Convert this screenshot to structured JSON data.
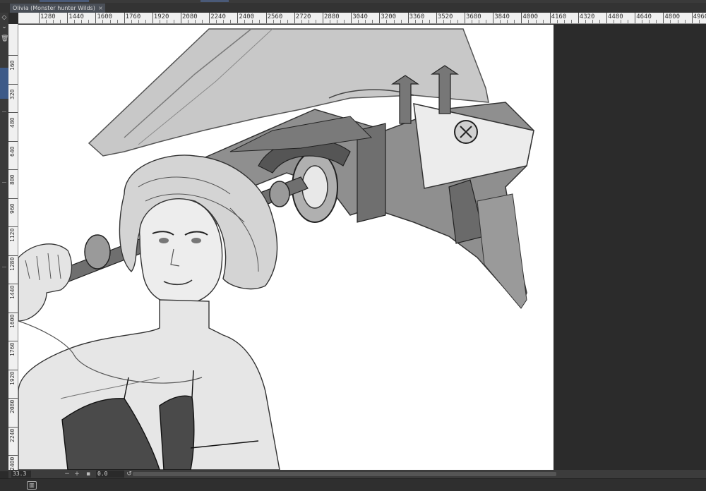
{
  "document": {
    "tab_title": "Olivia (Monster hunter Wilds)",
    "close_glyph": "×"
  },
  "rulers": {
    "horizontal_ticks": [
      "1280",
      "1440",
      "1600",
      "1760",
      "1920",
      "2080",
      "2240",
      "2400",
      "2560",
      "2720",
      "2880",
      "3040",
      "3200",
      "3360",
      "3520",
      "3680",
      "3840",
      "4000",
      "4160",
      "4320",
      "4480",
      "4640",
      "4800",
      "4960"
    ],
    "vertical_ticks": [
      "160",
      "320",
      "480",
      "640",
      "800",
      "960",
      "1120",
      "1280",
      "1440",
      "1600",
      "1760",
      "1920",
      "2080",
      "2240",
      "2400"
    ]
  },
  "status": {
    "zoom": "33.3",
    "angle": "0.0"
  },
  "icons": {
    "left_tool_1": "layer-icon",
    "left_tool_2": "chevron-down-icon",
    "left_tool_3": "trash-icon",
    "zoom_out": "minus-icon",
    "zoom_in": "plus-icon",
    "fit": "fit-icon",
    "rotate_left": "rotate-left-icon",
    "rotate_right": "rotate-right-icon",
    "reset": "reset-icon",
    "panel": "panel-icon"
  },
  "colors": {
    "workspace": "#2b2b2b",
    "canvas": "#ffffff",
    "ruler": "#f0f0f0",
    "tab": "#4a4f57",
    "accent": "#3d5a88"
  }
}
